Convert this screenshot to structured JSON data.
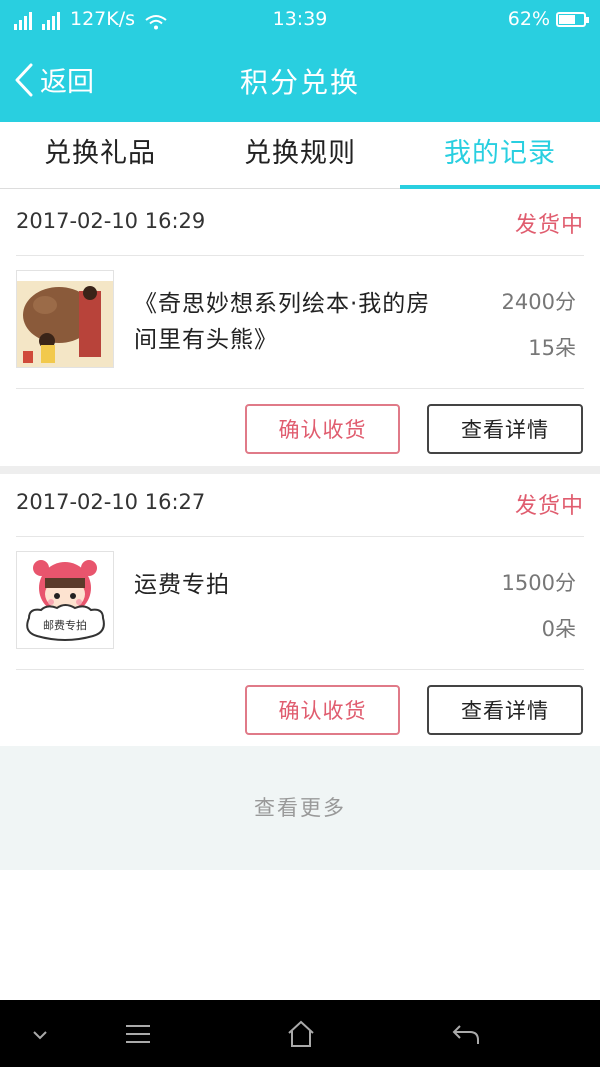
{
  "status_bar": {
    "network_speed": "127K/s",
    "time": "13:39",
    "battery": "62%",
    "battery_level": 0.62
  },
  "header": {
    "back_label": "返回",
    "title": "积分兑换"
  },
  "tabs": [
    {
      "label": "兑换礼品",
      "active": false
    },
    {
      "label": "兑换规则",
      "active": false
    },
    {
      "label": "我的记录",
      "active": true
    }
  ],
  "records": [
    {
      "datetime": "2017-02-10 16:29",
      "status": "发货中",
      "product_name": "《奇思妙想系列绘本·我的房间里有头熊》",
      "points": "2400分",
      "quantity": "15朵",
      "thumb_text": "",
      "confirm_label": "确认收货",
      "detail_label": "查看详情"
    },
    {
      "datetime": "2017-02-10 16:27",
      "status": "发货中",
      "product_name": "运费专拍",
      "points": "1500分",
      "quantity": "0朵",
      "thumb_text": "邮费专拍",
      "confirm_label": "确认收货",
      "detail_label": "查看详情"
    }
  ],
  "load_more_label": "查看更多",
  "system_nav": [
    "chevron-down-icon",
    "menu-icon",
    "home-icon",
    "back-icon"
  ],
  "colors": {
    "accent": "#29cfe0",
    "status": "#e05d6f"
  }
}
